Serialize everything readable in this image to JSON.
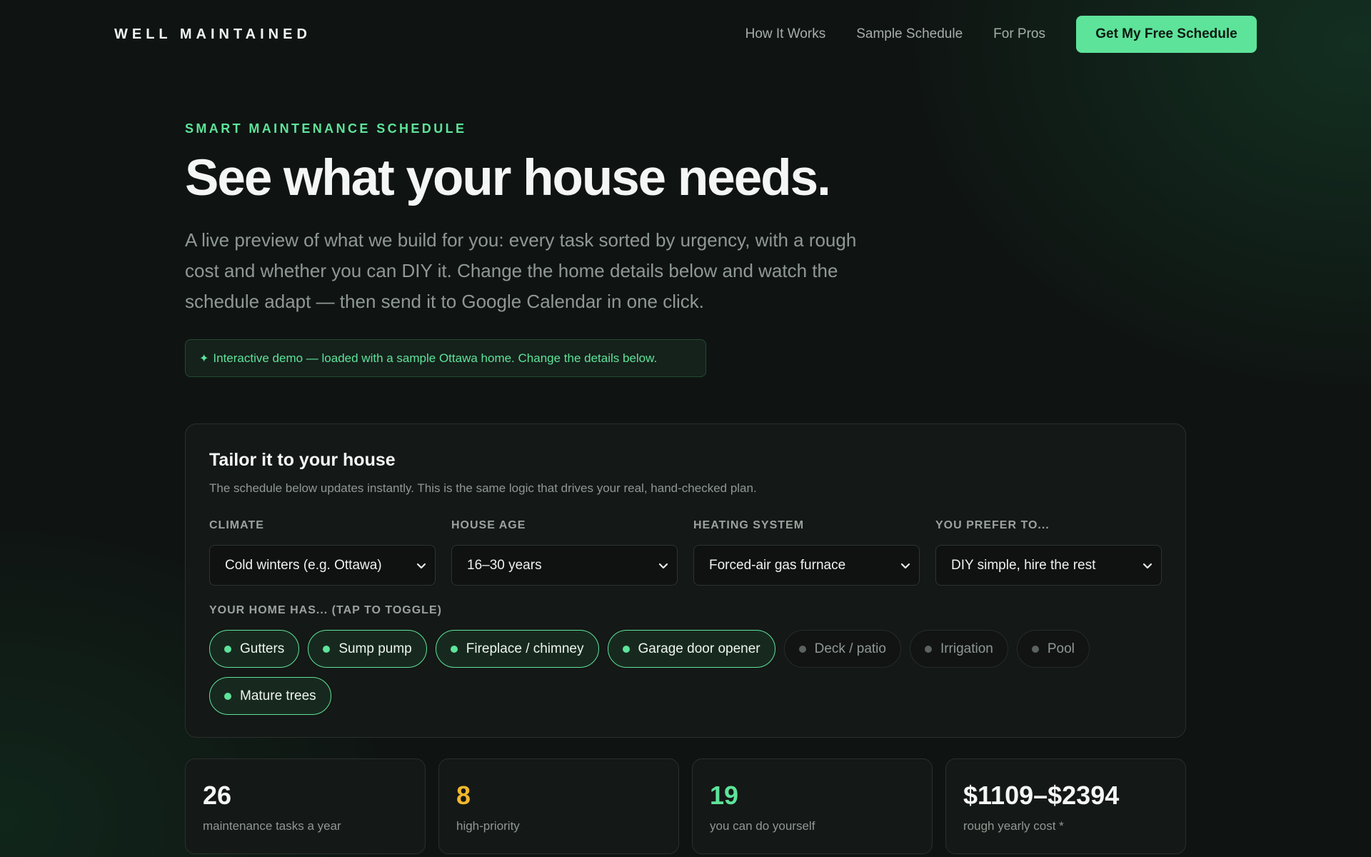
{
  "nav": {
    "logo": "WELL MAINTAINED",
    "links": [
      "How It Works",
      "Sample Schedule",
      "For Pros"
    ],
    "cta": "Get My Free Schedule"
  },
  "hero": {
    "eyebrow": "SMART MAINTENANCE SCHEDULE",
    "headline": "See what your house needs.",
    "lede": "A live preview of what we build for you: every task sorted by urgency, with a rough cost and whether you can DIY it. Change the home details below and watch the schedule adapt — then send it to Google Calendar in one click.",
    "badge_icon": "✦",
    "badge": "Interactive demo — loaded with a sample Ottawa home. Change the details below."
  },
  "panel": {
    "title": "Tailor it to your house",
    "subtitle": "The schedule below updates instantly. This is the same logic that drives your real, hand-checked plan.",
    "fields": [
      {
        "label": "CLIMATE",
        "value": "Cold winters (e.g. Ottawa)"
      },
      {
        "label": "HOUSE AGE",
        "value": "16–30 years"
      },
      {
        "label": "HEATING SYSTEM",
        "value": "Forced-air gas furnace"
      },
      {
        "label": "YOU PREFER TO...",
        "value": "DIY simple, hire the rest"
      }
    ],
    "toggles_label": "YOUR HOME HAS... (TAP TO TOGGLE)",
    "chips": [
      {
        "label": "Gutters",
        "on": true
      },
      {
        "label": "Sump pump",
        "on": true
      },
      {
        "label": "Fireplace / chimney",
        "on": true
      },
      {
        "label": "Garage door opener",
        "on": true
      },
      {
        "label": "Deck / patio",
        "on": false
      },
      {
        "label": "Irrigation",
        "on": false
      },
      {
        "label": "Pool",
        "on": false
      },
      {
        "label": "Mature trees",
        "on": true
      }
    ]
  },
  "stats": [
    {
      "value": "26",
      "label": "maintenance tasks a year",
      "color": "#f4f6f5"
    },
    {
      "value": "8",
      "label": "high-priority",
      "color": "#f2b82c"
    },
    {
      "value": "19",
      "label": "you can do yourself",
      "color": "#5ee39a"
    },
    {
      "value": "$1109–$2394",
      "label": "rough yearly cost *",
      "color": "#f4f6f5"
    }
  ],
  "colors": {
    "accent": "#5ee39a",
    "amber": "#f2b82c",
    "background": "#0f1412"
  }
}
